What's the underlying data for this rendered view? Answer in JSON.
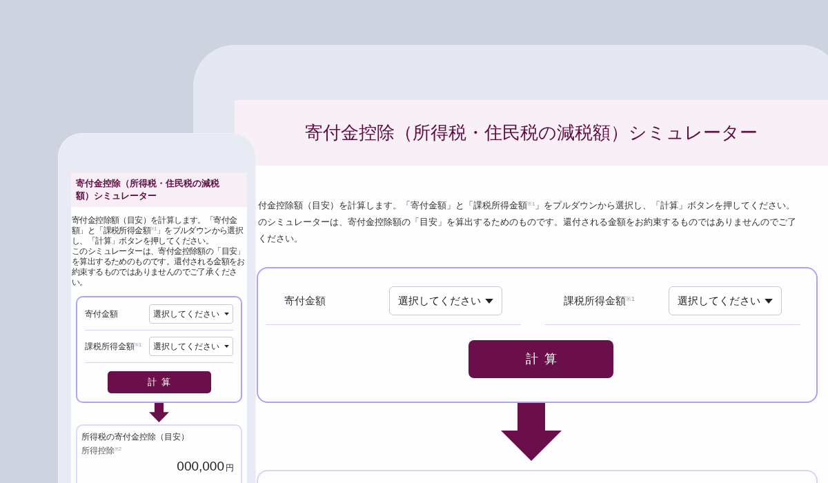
{
  "tablet": {
    "title": "寄付金控除（所得税・住民税の減税額）シミュレーター",
    "intro_lines": [
      "付金控除額（目安）を計算します。「寄付金額」と「課税所得金額$^{※1}$」をプルダウンから選択し、「計算」ボタンを押してください。",
      "のシミュレーターは、寄付金控除額の「目安」を算出するためのものです。還付される金額をお約束するものではありませんのでご了",
      "ください。"
    ],
    "form": {
      "fields": [
        {
          "label": "寄付金額",
          "placeholder": "選択してください"
        },
        {
          "label": "課税所得金額$^{※1}$",
          "placeholder": "選択してください"
        }
      ],
      "button": "計算"
    }
  },
  "phone": {
    "title": "寄付金控除（所得税・住民税の減税額）シミュレーター",
    "intro": [
      "寄付金控除額（目安）を計算します。「寄付金額」と「課税所得金額$^{※1}$」をプルダウンから選択し、「計算」ボタンを押してください。",
      "このシミュレーターは、寄付金控除額の「目安」を算出するためのものです。還付される金額をお約束するものではありませんのでご了承ください。"
    ],
    "form": {
      "fields": [
        {
          "label": "寄付金額",
          "placeholder": "選択してください"
        },
        {
          "label": "課税所得金額$^{※1}$",
          "placeholder": "選択してください"
        }
      ],
      "button": "計算"
    },
    "result": {
      "heading": "所得税の寄付金控除（目安）",
      "label": "所得控除$^{※2}$",
      "amount": "000,000",
      "unit": "円"
    }
  }
}
